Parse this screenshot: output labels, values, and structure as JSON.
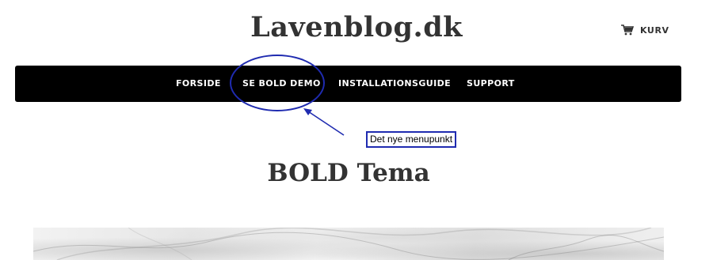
{
  "header": {
    "site_title": "Lavenblog.dk",
    "cart_label": "KURV",
    "cart_icon": "shopping-cart-icon"
  },
  "nav": {
    "items": [
      {
        "label": "FORSIDE"
      },
      {
        "label": "SE BOLD DEMO"
      },
      {
        "label": "INSTALLATIONSGUIDE"
      },
      {
        "label": "SUPPORT"
      }
    ]
  },
  "annotation": {
    "label": "Det nye menupunkt",
    "color": "#1f2bb0"
  },
  "main": {
    "heading": "BOLD Tema"
  },
  "colors": {
    "navbar_bg": "#000000",
    "nav_text": "#ffffff",
    "heading_text": "#333333"
  }
}
